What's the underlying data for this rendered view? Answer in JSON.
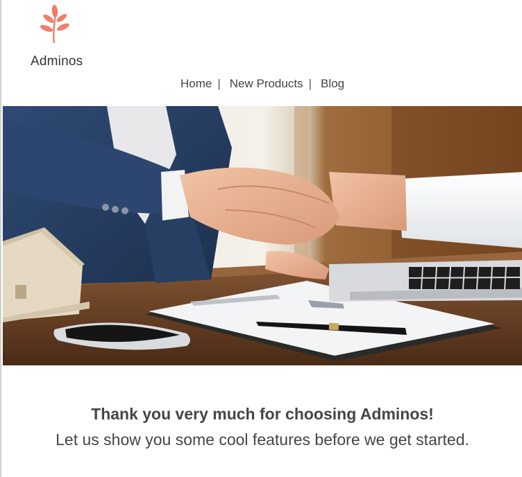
{
  "brand": {
    "name": "Adminos",
    "logo_icon": "leaf-branch-icon",
    "accent_color": "#ef7f6a"
  },
  "nav": {
    "items": [
      {
        "label": "Home"
      },
      {
        "label": "New Products"
      },
      {
        "label": "Blog"
      }
    ],
    "separator": "|"
  },
  "hero": {
    "image": "business-handshake-photo"
  },
  "message": {
    "headline": "Thank you very much for choosing Adminos!",
    "subline": "Let us show you some cool features before we get started."
  }
}
